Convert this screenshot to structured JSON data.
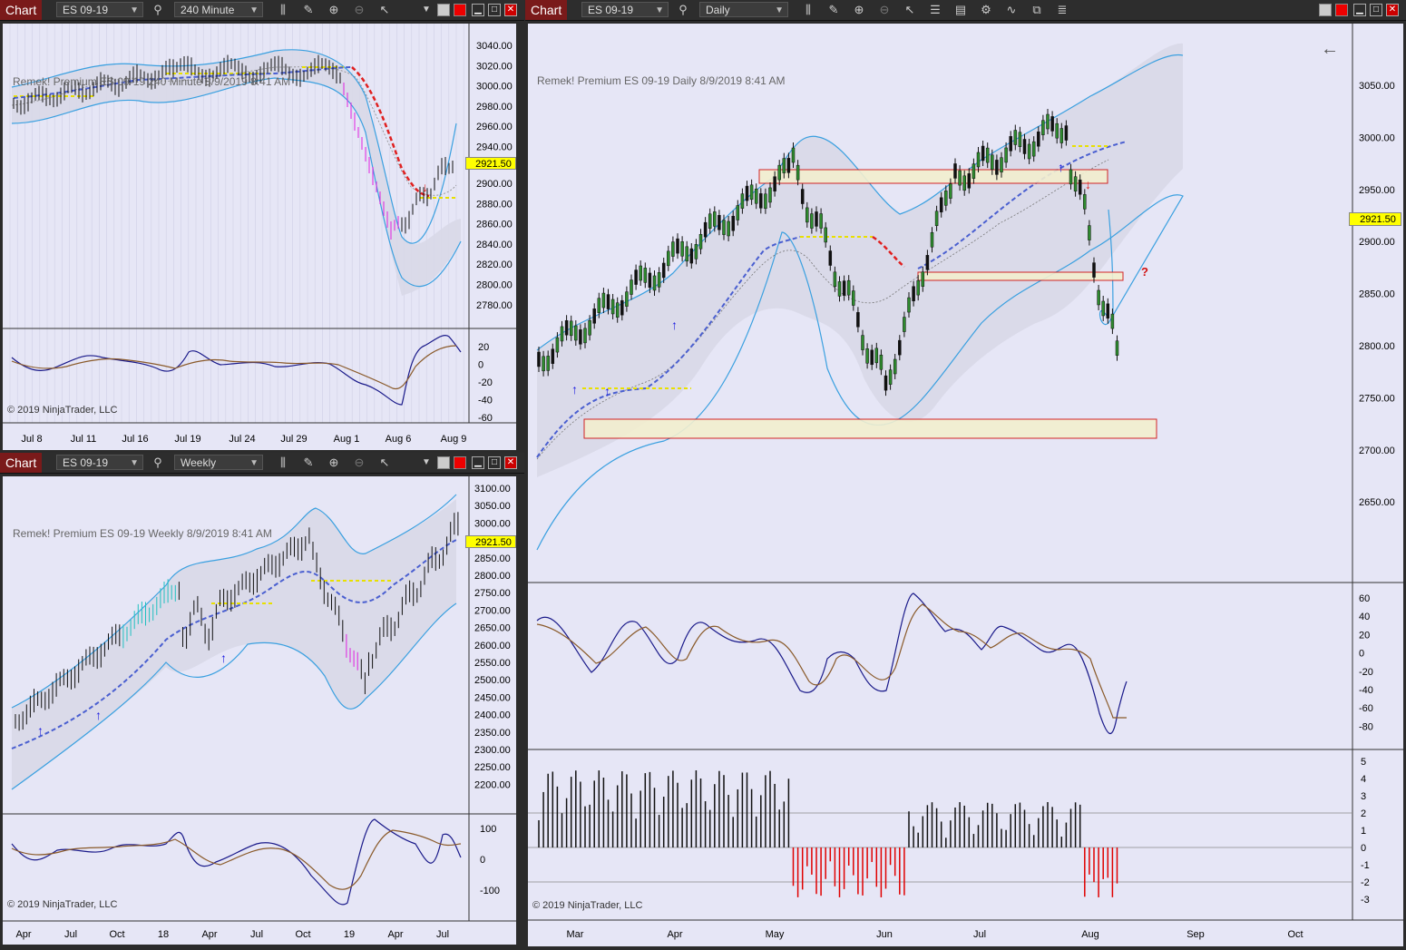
{
  "app_label": "Chart",
  "top_left": {
    "instrument": "ES 09-19",
    "period": "240 Minute",
    "title": "Remek!  Premium  ES 09-19  240 Minute  8/9/2019 8:41 AM",
    "price_badge": "2921.50",
    "y_ticks": [
      "3040.00",
      "3020.00",
      "3000.00",
      "2980.00",
      "2960.00",
      "2940.00",
      "2900.00",
      "2880.00",
      "2860.00",
      "2840.00",
      "2820.00",
      "2800.00",
      "2780.00"
    ],
    "osc_ticks": [
      "20",
      "0",
      "-20",
      "-40",
      "-60"
    ],
    "x_ticks": [
      "Jul 8",
      "Jul 11",
      "Jul 16",
      "Jul 19",
      "Jul 24",
      "Jul 29",
      "Aug 1",
      "Aug 6",
      "Aug 9"
    ],
    "copyright": "© 2019 NinjaTrader, LLC"
  },
  "bottom_left": {
    "instrument": "ES 09-19",
    "period": "Weekly",
    "title": "Remek!  Premium  ES 09-19  Weekly  8/9/2019 8:41 AM",
    "price_badge": "2921.50",
    "y_ticks": [
      "3100.00",
      "3050.00",
      "3000.00",
      "2950.00",
      "2850.00",
      "2800.00",
      "2750.00",
      "2700.00",
      "2650.00",
      "2600.00",
      "2550.00",
      "2500.00",
      "2450.00",
      "2400.00",
      "2350.00",
      "2300.00",
      "2250.00",
      "2200.00"
    ],
    "osc_ticks": [
      "100",
      "0",
      "-100"
    ],
    "x_ticks": [
      "Apr",
      "Jul",
      "Oct",
      "18",
      "Apr",
      "Jul",
      "Oct",
      "19",
      "Apr",
      "Jul"
    ],
    "copyright": "© 2019 NinjaTrader, LLC"
  },
  "right": {
    "instrument": "ES 09-19",
    "period": "Daily",
    "title": "Remek!  Premium  ES 09-19  Daily  8/9/2019 8:41 AM",
    "price_badge": "2921.50",
    "question_mark": "?",
    "y_ticks": [
      "3050.00",
      "3000.00",
      "2950.00",
      "2900.00",
      "2850.00",
      "2800.00",
      "2750.00",
      "2700.00",
      "2650.00"
    ],
    "osc_ticks": [
      "60",
      "40",
      "20",
      "0",
      "-20",
      "-40",
      "-60",
      "-80"
    ],
    "hist_ticks": [
      "5",
      "4",
      "3",
      "2",
      "1",
      "0",
      "-1",
      "-2",
      "-3"
    ],
    "x_ticks": [
      "Mar",
      "Apr",
      "May",
      "Jun",
      "Jul",
      "Aug",
      "Sep",
      "Oct"
    ],
    "copyright": "© 2019 NinjaTrader, LLC"
  },
  "colors": {
    "plot_bg": "#e6e6f6",
    "band": "#3aa0e0",
    "midline_dash": "#4a5fd0",
    "yellow_line": "#e8e000",
    "red_dash": "#e02020",
    "magenta_bars": "#e020e0",
    "cyan_bars": "#20c0c0",
    "badge": "#ffff00",
    "zone_fill": "#f3efcf",
    "zone_border": "#d01010"
  }
}
